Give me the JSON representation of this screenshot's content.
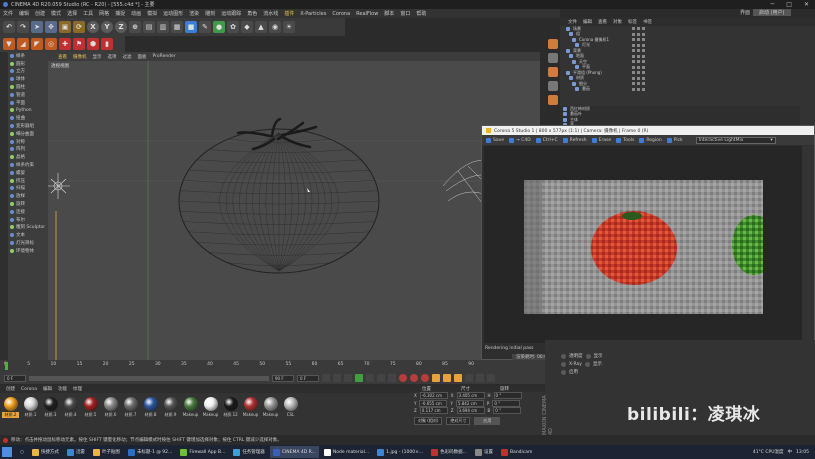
{
  "window": {
    "title": "CINEMA 4D R20.059 Studio (RC - R20) - [555.c4d *] - 主要",
    "controls": [
      "─",
      "□",
      "✕"
    ]
  },
  "menubar": {
    "items": [
      "文件",
      "编辑",
      "创建",
      "模式",
      "选择",
      "工具",
      "网格",
      "捕捉",
      "动画",
      "模拟",
      "运动图形",
      "渲染",
      "雕刻",
      "运动跟踪",
      "角色",
      "流水线",
      "插件",
      "X-Particles",
      "Corona",
      "RealFlow",
      "脚本",
      "窗口",
      "帮助"
    ],
    "highlight_index": 16
  },
  "layout": {
    "label": "界面",
    "value": "启动 (用户)"
  },
  "viewport": {
    "menu": [
      "查看",
      "摄像机",
      "显示",
      "选项",
      "过滤",
      "面板",
      "ProRender"
    ],
    "label": "透视视图"
  },
  "left_panel": {
    "items": [
      "样条",
      "圆形",
      "立方",
      "球体",
      "圆柱",
      "管道",
      "平面",
      "Python",
      "扭曲",
      "变形器组",
      "细分曲面",
      "对称",
      "阵列",
      "晶格",
      "样条约束",
      "螺旋",
      "挤压",
      "扫描",
      "放样",
      "旋转",
      "连接",
      "布尔",
      "雕刻 Sculptor",
      "文本",
      "灯光目标",
      "环境物体"
    ]
  },
  "object_manager": {
    "menu": [
      "文件",
      "编辑",
      "查看",
      "对象",
      "标签",
      "书签"
    ],
    "rows": [
      "场景",
      "组",
      "Corona 摄像机1",
      "灯光",
      "背景",
      "地面",
      "天空",
      "平面",
      "平滑组 (Phong)",
      "材质",
      "细分",
      "番茄"
    ],
    "lower_rows": [
      "西红柿材质",
      "番茄叶",
      "主体",
      "茎",
      "叶"
    ]
  },
  "preview": {
    "title": "Corona 5 Studio 1 | 800 x 577px (1:1) | Camera: 摄像机 | Frame 0 (R)",
    "toolbar": [
      "Save",
      "→ C4D",
      "Ctrl+C",
      "Refresh",
      "Erase",
      "Tools",
      "Region",
      "Pick"
    ],
    "dropdown": "Interactive LightMix",
    "status": "Rendering initial pass",
    "bottom": "渲染耗时: 00:00 cm"
  },
  "timeline": {
    "ticks": [
      "0",
      "5",
      "10",
      "15",
      "20",
      "25",
      "30",
      "35",
      "40",
      "45",
      "50",
      "55",
      "60",
      "65",
      "70",
      "75",
      "80",
      "85",
      "90"
    ],
    "start_field": "0 F",
    "end_field": "90 F",
    "current_field": "0 F"
  },
  "materials": {
    "menu": [
      "创建",
      "Corona",
      "编辑",
      "功能",
      "纹理"
    ],
    "items": [
      {
        "label": "材质.2",
        "color": "#f0a020"
      },
      {
        "label": "材质.1",
        "color": "#d8d8d8"
      },
      {
        "label": "材质.3",
        "color": "#202020"
      },
      {
        "label": "材质.4",
        "color": "#4a4a4a"
      },
      {
        "label": "材质.5",
        "color": "#a32121"
      },
      {
        "label": "材质.6",
        "color": "#8a8a8a"
      },
      {
        "label": "材质.7",
        "color": "#6d6d6d"
      },
      {
        "label": "材质.8",
        "color": "#2c57a0"
      },
      {
        "label": "材质.9",
        "color": "#555555"
      },
      {
        "label": "Makeup",
        "color": "#4a7a3e"
      },
      {
        "label": "Makeup",
        "color": "#f0f0f0"
      },
      {
        "label": "材质.12",
        "color": "#1a1a1a"
      },
      {
        "label": "Makeup",
        "color": "#b03030"
      },
      {
        "label": "Makeup",
        "color": "#999999"
      },
      {
        "label": "CSL",
        "color": "#bbbbbb"
      }
    ]
  },
  "coords": {
    "headers": [
      "位置",
      "尺寸",
      "旋转"
    ],
    "rows": [
      {
        "axis": "X",
        "pos": "-6.302 cm",
        "size": "3.405 cm",
        "rot": "0 °",
        "rl": "H"
      },
      {
        "axis": "Y",
        "pos": "-0.655 cm",
        "size": "5.842 cm",
        "rot": "0 °",
        "rl": "P"
      },
      {
        "axis": "Z",
        "pos": "0.117 cm",
        "size": "3.694 cm",
        "rot": "0 °",
        "rl": "B"
      }
    ],
    "mode": "对象 (相对)",
    "size_mode": "绝对尺寸",
    "apply": "应用"
  },
  "attributes": {
    "rows": [
      "透明度",
      "X-Ray",
      "启用"
    ],
    "rows2": [
      "显示",
      "显示",
      "编辑"
    ]
  },
  "watermark": "bilibili：凌琪冰",
  "maxon": "MAXON CINEMA 4D",
  "statusbar": "移动：点击并拖动鼠标移动元素。按住 SHIFT 键量化移动；节点编辑模式时按住 SHIFT 键增加选择对象；按住 CTRL 键减少选择对象。",
  "taskbar": {
    "items": [
      {
        "label": "快捷方式",
        "color": "#e8b740"
      },
      {
        "label": "迅雷",
        "color": "#3a85d8"
      },
      {
        "label": "叶子贴图",
        "color": "#e8b740"
      },
      {
        "label": "未标题-1 @ 92...",
        "color": "#2d6ec5"
      },
      {
        "label": "Firewall App B...",
        "color": "#6fbf3f"
      },
      {
        "label": "任务管理器",
        "color": "#3aa0d8"
      },
      {
        "label": "CINEMA 4D R...",
        "color": "#3a5fb8"
      },
      {
        "label": "Node material...",
        "color": "#ffffff"
      },
      {
        "label": "1.jpg - (1000×...",
        "color": "#3a85d8"
      },
      {
        "label": "色彩码数据...",
        "color": "#c03030"
      },
      {
        "label": "设置",
        "color": "#888888"
      },
      {
        "label": "Bandicam",
        "color": "#c03030"
      }
    ],
    "tray": [
      "41°C CPU温度",
      "中",
      "13:05"
    ]
  }
}
